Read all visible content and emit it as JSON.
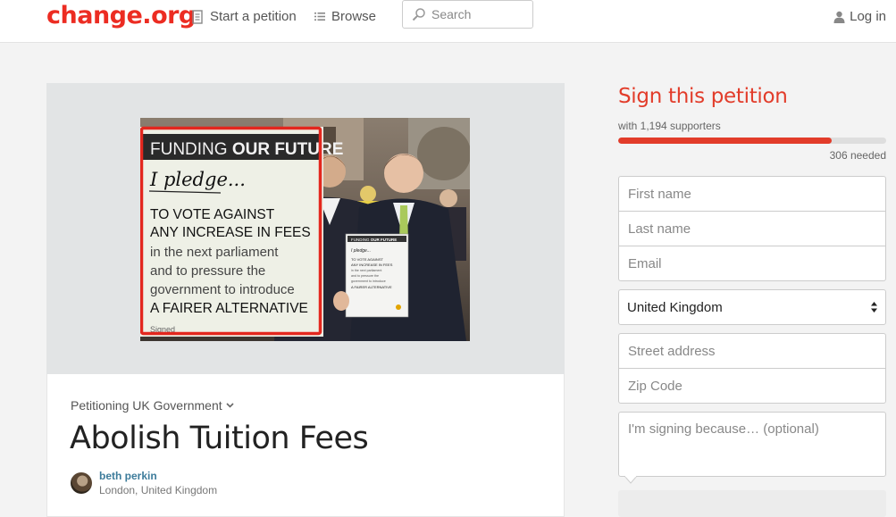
{
  "header": {
    "logo": "change.org",
    "start_petition": "Start a petition",
    "browse": "Browse",
    "search_placeholder": "Search",
    "login": "Log in"
  },
  "photo": {
    "sign_heading_light": "FUNDING ",
    "sign_heading_bold": "OUR FUTURE",
    "sign_pledge": "I pledge...",
    "sign_lines": [
      "TO VOTE AGAINST",
      "ANY INCREASE IN FEES",
      "in the next parliament",
      "and to pressure the",
      "government to introduce",
      "A FAIRER ALTERNATIVE"
    ],
    "sign_signed": "Signed"
  },
  "petition": {
    "petitioning": "Petitioning UK Government",
    "title": "Abolish Tuition Fees",
    "author": "beth perkin",
    "location": "London, United Kingdom"
  },
  "sidebar": {
    "title": "Sign this petition",
    "supporters": "with 1,194 supporters",
    "progress": 0.796,
    "needed": "306 needed",
    "first_name_placeholder": "First name",
    "last_name_placeholder": "Last name",
    "email_placeholder": "Email",
    "country": "United Kingdom",
    "street_placeholder": "Street address",
    "zip_placeholder": "Zip Code",
    "reason_placeholder": "I'm signing because… (optional)"
  },
  "colors": {
    "brand": "#ec2c22",
    "accent": "#e23c2a",
    "author_link": "#3d7c9b"
  }
}
